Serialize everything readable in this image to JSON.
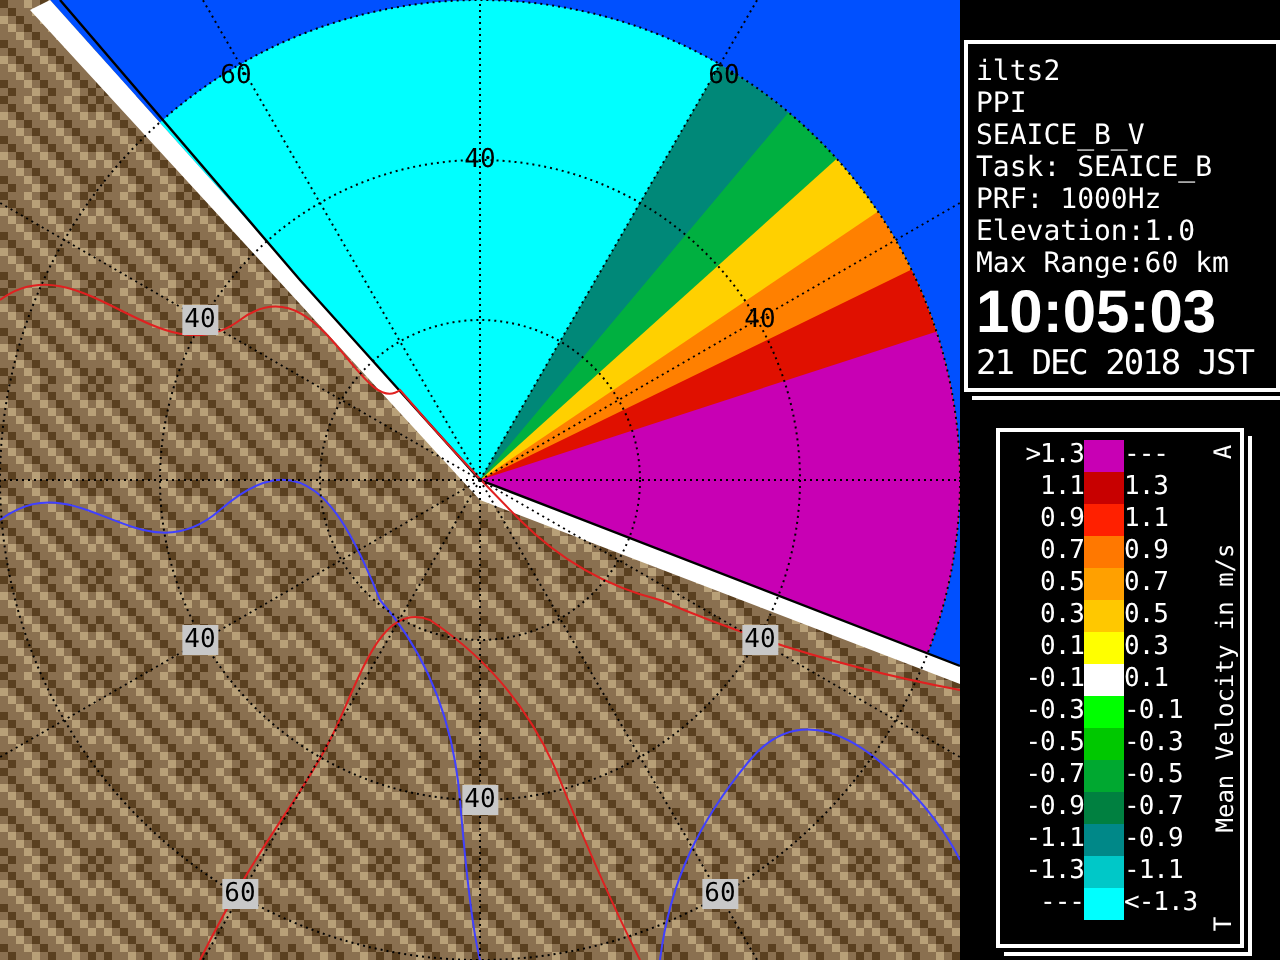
{
  "map": {
    "range_labels": [
      {
        "text": "60",
        "boxed": false
      },
      {
        "text": "60",
        "boxed": false
      },
      {
        "text": "40",
        "boxed": false
      },
      {
        "text": "40",
        "boxed": true
      },
      {
        "text": "40",
        "boxed": false
      },
      {
        "text": "40",
        "boxed": true
      },
      {
        "text": "40",
        "boxed": true
      },
      {
        "text": "40",
        "boxed": true
      },
      {
        "text": "60",
        "boxed": true
      },
      {
        "text": "60",
        "boxed": true
      }
    ]
  },
  "info": {
    "lines": [
      "ilts2",
      "PPI",
      "SEAICE_B_V",
      "Task: SEAICE_B",
      "PRF: 1000Hz",
      "Elevation:1.0",
      "Max Range:60 km"
    ],
    "time": "10:05:03",
    "date": "21 DEC 2018 JST"
  },
  "legend": {
    "title": "Mean Velocity in m/s",
    "top_mark": "A",
    "bottom_mark": "T",
    "rows": [
      {
        "low": ">1.3",
        "high": "---",
        "color": "#c800b4"
      },
      {
        "low": "1.1",
        "high": "1.3",
        "color": "#c80000"
      },
      {
        "low": "0.9",
        "high": "1.1",
        "color": "#ff2000"
      },
      {
        "low": "0.7",
        "high": "0.9",
        "color": "#ff7800"
      },
      {
        "low": "0.5",
        "high": "0.7",
        "color": "#ffa000"
      },
      {
        "low": "0.3",
        "high": "0.5",
        "color": "#ffc800"
      },
      {
        "low": "0.1",
        "high": "0.3",
        "color": "#ffff00"
      },
      {
        "low": "-0.1",
        "high": "0.1",
        "color": "#ffffff"
      },
      {
        "low": "-0.3",
        "high": "-0.1",
        "color": "#00ff00"
      },
      {
        "low": "-0.5",
        "high": "-0.3",
        "color": "#00c800"
      },
      {
        "low": "-0.7",
        "high": "-0.5",
        "color": "#00a830"
      },
      {
        "low": "-0.9",
        "high": "-0.7",
        "color": "#008040"
      },
      {
        "low": "-1.1",
        "high": "-0.9",
        "color": "#008888"
      },
      {
        "low": "-1.3",
        "high": "-1.1",
        "color": "#00c8c8"
      },
      {
        "low": "---",
        "high": "<-1.3",
        "color": "#00ffff"
      }
    ]
  }
}
